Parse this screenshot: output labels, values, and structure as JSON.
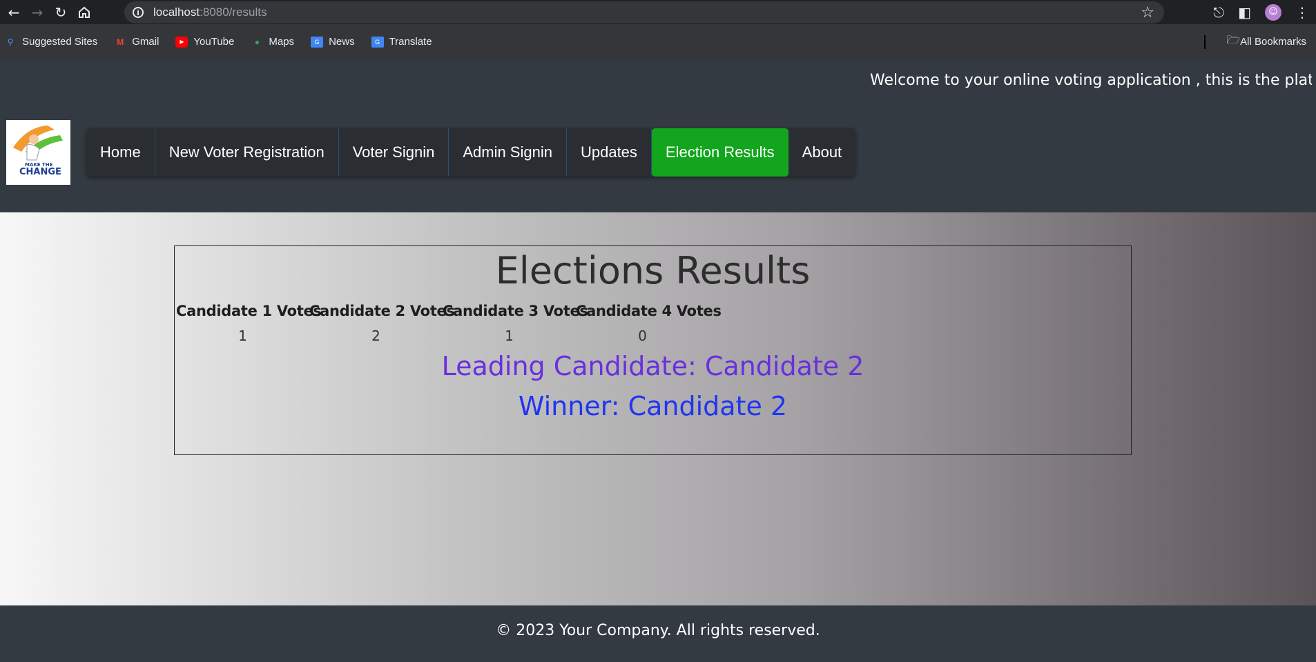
{
  "browser": {
    "url_host": "localhost",
    "url_path": ":8080/results",
    "bookmarks": [
      "Suggested Sites",
      "Gmail",
      "YouTube",
      "Maps",
      "News",
      "Translate"
    ],
    "all_bookmarks": "All Bookmarks"
  },
  "header": {
    "marquee": "Welcome to your online voting application , this is the platform",
    "logo_line1": "MAKE THE",
    "logo_line2": "CHANGE",
    "nav": [
      "Home",
      "New Voter Registration",
      "Voter Signin",
      "Admin Signin",
      "Updates",
      "Election Results",
      "About"
    ]
  },
  "results": {
    "title": "Elections Results",
    "columns": [
      "Candidate 1 Votes",
      "Candidate 2 Votes",
      "Candidate 3 Votes",
      "Candidate 4 Votes"
    ],
    "values": [
      "1",
      "2",
      "1",
      "0"
    ],
    "leading": "Leading Candidate: Candidate 2",
    "winner": "Winner: Candidate 2"
  },
  "footer": {
    "text": "© 2023 Your Company. All rights reserved."
  },
  "colors": {
    "active_nav": "#12a51d",
    "leading": "#6a2fdd",
    "winner": "#2035f0"
  }
}
